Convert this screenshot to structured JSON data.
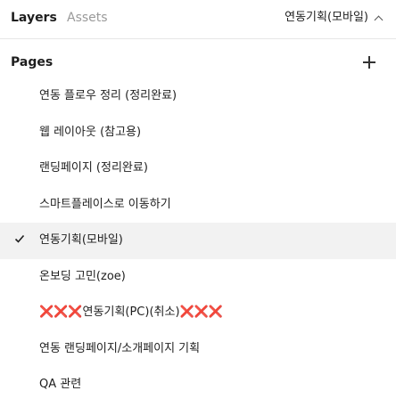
{
  "tabs": {
    "layers": "Layers",
    "assets": "Assets"
  },
  "current_page_dropdown": {
    "label": "연동기획(모바일)",
    "icon": "chevron-up-icon"
  },
  "pages_section": {
    "title": "Pages",
    "add_icon": "plus-icon"
  },
  "pages": [
    {
      "label": "연동 플로우 정리 (정리완료)",
      "selected": false
    },
    {
      "label": "웹 레이아웃 (참고용)",
      "selected": false
    },
    {
      "label": "랜딩페이지 (정리완료)",
      "selected": false
    },
    {
      "label": "스마트플레이스로 이동하기",
      "selected": false
    },
    {
      "label": "연동기획(모바일)",
      "selected": true
    },
    {
      "label": "온보딩 고민(zoe)",
      "selected": false
    },
    {
      "label": "❌❌❌연동기획(PC)(취소)❌❌❌",
      "selected": false
    },
    {
      "label": "연동 랜딩페이지/소개페이지 기획",
      "selected": false
    },
    {
      "label": "QA 관련",
      "selected": false
    }
  ],
  "colors": {
    "selected_row_bg": "#f2f2f2",
    "muted_tab": "#9a9a9a",
    "text": "#1e1e1e"
  }
}
